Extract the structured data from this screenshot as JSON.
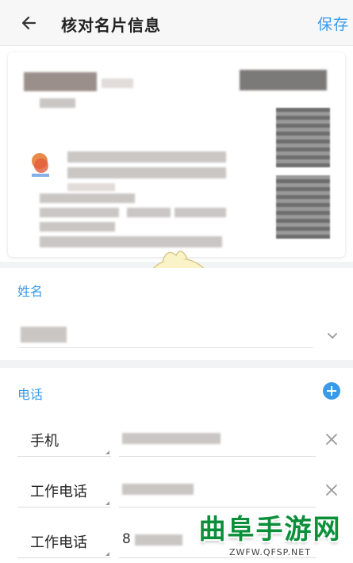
{
  "header": {
    "title": "核对名片信息",
    "save_label": "保存",
    "back_icon": "arrow-left-icon"
  },
  "name_section": {
    "label": "姓名",
    "chevron_icon": "chevron-down-icon"
  },
  "phone_section": {
    "label": "电话",
    "add_icon": "plus-circle-icon",
    "rows": [
      {
        "type": "手机",
        "value": ""
      },
      {
        "type": "工作电话",
        "value": ""
      },
      {
        "type": "工作电话",
        "value": "8"
      }
    ]
  },
  "watermark": {
    "text": "曲阜手游网",
    "url": "ZWFW.QFSP.NET"
  },
  "colors": {
    "accent": "#3a9ae8",
    "watermark_green": "#0b8f3a"
  }
}
